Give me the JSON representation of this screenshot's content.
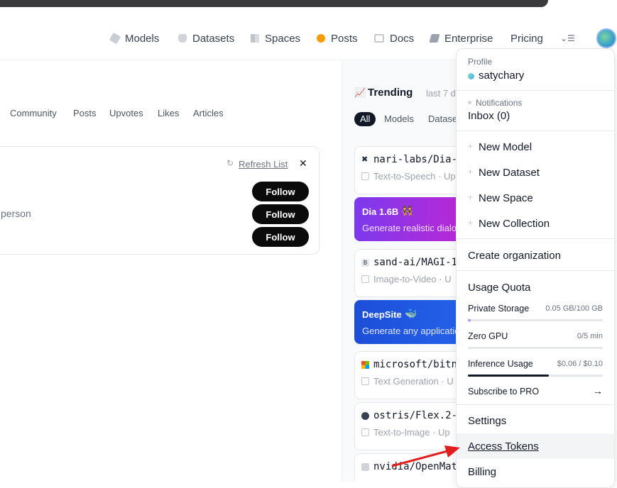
{
  "nav": {
    "models": "Models",
    "datasets": "Datasets",
    "spaces": "Spaces",
    "posts": "Posts",
    "docs": "Docs",
    "enterprise": "Enterprise",
    "pricing": "Pricing"
  },
  "feed_tabs": [
    "Community",
    "Posts",
    "Upvotes",
    "Likes",
    "Articles"
  ],
  "suggestions": {
    "refresh_label": "Refresh List",
    "person_text": "person",
    "follow_label": "Follow"
  },
  "trending": {
    "title": "Trending",
    "period": "last 7 d",
    "filters": [
      "All",
      "Models",
      "Datase"
    ],
    "items": [
      {
        "name": "nari-labs/Dia-",
        "meta": "Text-to-Speech · Up"
      },
      {
        "name": "sand-ai/MAGI-1",
        "meta": "Image-to-Video · U"
      },
      {
        "name": "microsoft/bitn",
        "meta": "Text Generation · U"
      },
      {
        "name": "ostris/Flex.2-",
        "meta": "Text-to-Image · Up"
      },
      {
        "name": "nvidia/OpenMat",
        "meta": ""
      }
    ],
    "spaces": [
      {
        "name": "Dia 1.6B",
        "desc": "Generate realistic dialog",
        "color_from": "#7c3aed",
        "color_to": "#d946ef"
      },
      {
        "name": "DeepSite",
        "desc": "Generate any application",
        "color_from": "#2563eb",
        "color_to": "#3b82f6"
      }
    ]
  },
  "menu": {
    "profile_label": "Profile",
    "username": "satychary",
    "notifications_label": "Notifications",
    "inbox": "Inbox (0)",
    "new_items": [
      "New Model",
      "New Dataset",
      "New Space",
      "New Collection"
    ],
    "create_org": "Create organization",
    "usage_quota": "Usage Quota",
    "quotas": [
      {
        "label": "Private Storage",
        "value": "0.05 GB/100 GB",
        "fraction": 0.02,
        "color": "#c084fc"
      },
      {
        "label": "Zero GPU",
        "value": "0/5 min",
        "fraction": 0.0,
        "color": "#111827"
      },
      {
        "label": "Inference Usage",
        "value": "$0.06 / $0.10",
        "fraction": 0.6,
        "color": "#111827"
      }
    ],
    "subscribe": "Subscribe to PRO",
    "arrow": "→",
    "settings": "Settings",
    "access_tokens": "Access Tokens",
    "billing": "Billing"
  }
}
